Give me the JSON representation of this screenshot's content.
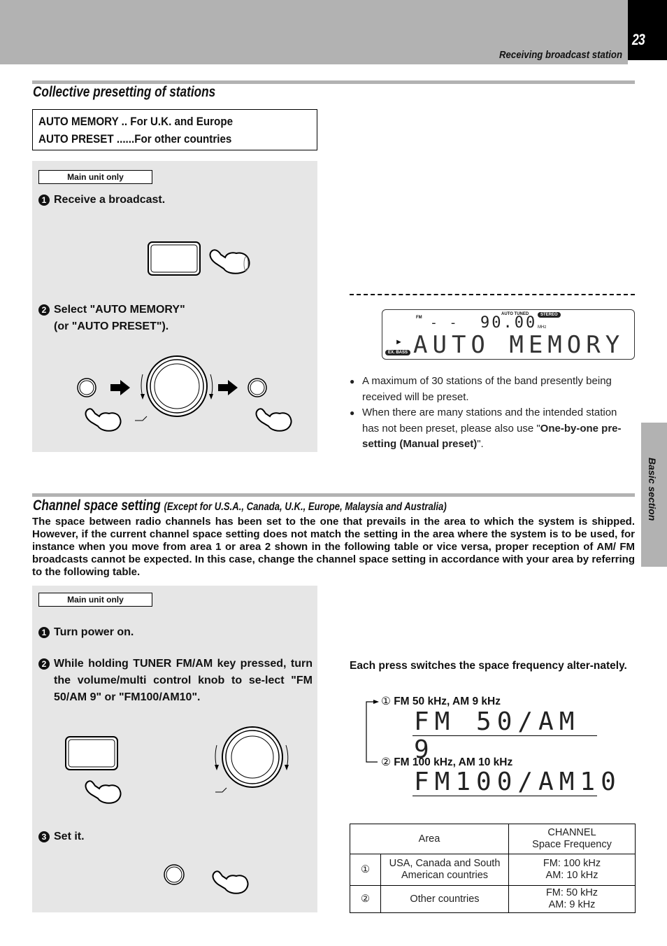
{
  "header": {
    "page_number": "23",
    "running_head": "Receiving broadcast station"
  },
  "side_tab": {
    "label": "Basic section"
  },
  "collective": {
    "title": "Collective presetting of stations",
    "modes": [
      {
        "name": "AUTO MEMORY",
        "sep": " .. ",
        "desc": "For U.K. and Europe"
      },
      {
        "name": "AUTO PRESET",
        "sep": " ......",
        "desc": "For other countries"
      }
    ],
    "badge": "Main unit only",
    "steps": [
      {
        "num": "1",
        "text": "Receive a broadcast."
      },
      {
        "num": "2",
        "text": "Select \"AUTO  MEMORY\"",
        "text2": "(or \"AUTO PRESET\")."
      }
    ],
    "display": {
      "band": "FM",
      "preset": "- -",
      "frequency": "90.00",
      "unit": "MHz",
      "auto_tuned": "AUTO TUNED",
      "stereo": "STEREO",
      "ex_bass": "EX. BASS",
      "main_text": "AUTO MEMORY"
    },
    "notes": [
      {
        "text": "A maximum of 30 stations of the band presently being received will be preset."
      },
      {
        "text": "When there are many stations and the intended station has not been preset, please also use \"",
        "bold": "One-by-one pre-setting (Manual preset)",
        "tail": "\"."
      }
    ]
  },
  "channel": {
    "title": "Channel space setting",
    "subtitle": "(Except  for U.S.A., Canada, U.K., Europe, Malaysia and Australia)",
    "intro": "The space between radio channels has been set to the one that prevails in the area to which the system is shipped. However, if the current channel space setting does not match the setting in the area where the system is to be used, for instance when you move from area 1 or area 2 shown in the following table or vice versa, proper reception of AM/ FM broadcasts cannot be expected. In this case, change the channel space setting in accordance with your area by referring to the following table.",
    "badge": "Main unit only",
    "steps": [
      {
        "num": "1",
        "text": "Turn power on."
      },
      {
        "num": "2",
        "text": "While holding TUNER FM/AM key pressed, turn the volume/multi control knob to se-lect \"FM 50/AM   9\" or \"FM100/AM10\"."
      },
      {
        "num": "3",
        "text": "Set it."
      }
    ],
    "switch_text": "Each press switches the space frequency alter-nately.",
    "options": [
      {
        "marker": "①",
        "label": "FM 50 kHz, AM 9 kHz",
        "display": "FM 50/AM 9"
      },
      {
        "marker": "②",
        "label": "FM 100 kHz, AM 10 kHz",
        "display": "FM100/AM10"
      }
    ],
    "table": {
      "headers": {
        "area": "Area",
        "freq_line1": "CHANNEL",
        "freq_line2": "Space Frequency"
      },
      "rows": [
        {
          "marker": "①",
          "area_line1": "USA, Canada and South",
          "area_line2": "American countries",
          "fm": "FM: 100 kHz",
          "am": "AM: 10 kHz"
        },
        {
          "marker": "②",
          "area_line1": "Other countries",
          "area_line2": "",
          "fm": "FM: 50 kHz",
          "am": "AM: 9 kHz"
        }
      ]
    }
  }
}
